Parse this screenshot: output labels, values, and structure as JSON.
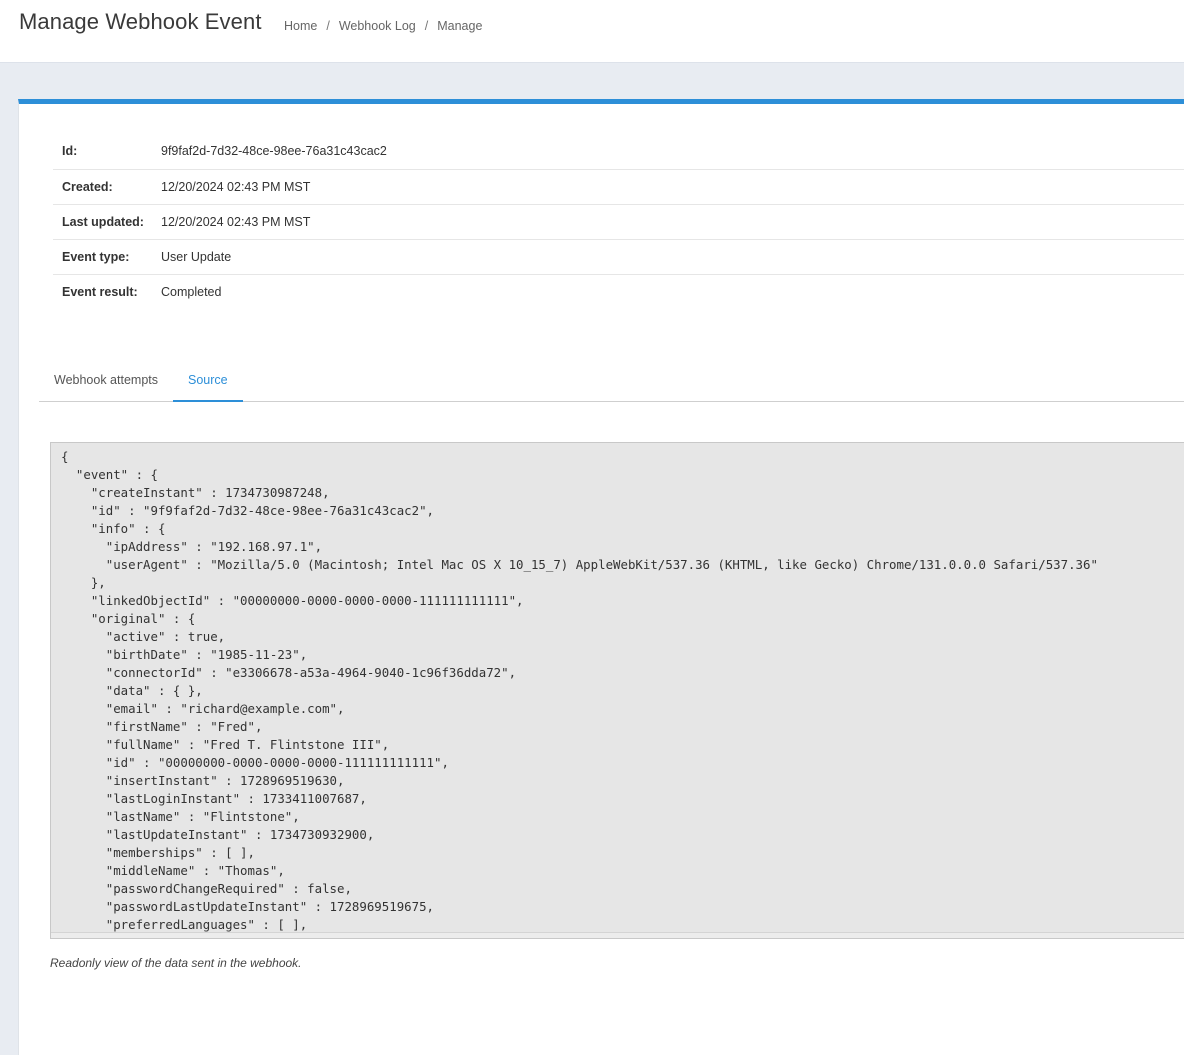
{
  "header": {
    "title": "Manage Webhook Event",
    "breadcrumb": [
      {
        "label": "Home"
      },
      {
        "label": "Webhook Log"
      },
      {
        "label": "Manage"
      }
    ],
    "separator": "/"
  },
  "details": {
    "id_label": "Id:",
    "id_value": "9f9faf2d-7d32-48ce-98ee-76a31c43cac2",
    "created_label": "Created:",
    "created_value": "12/20/2024 02:43 PM MST",
    "updated_label": "Last updated:",
    "updated_value": "12/20/2024 02:43 PM MST",
    "type_label": "Event type:",
    "type_value": "User Update",
    "result_label": "Event result:",
    "result_value": "Completed"
  },
  "tabs": [
    {
      "label": "Webhook attempts",
      "active": false
    },
    {
      "label": "Source",
      "active": true
    }
  ],
  "source": {
    "lines": [
      "{",
      "  \"event\" : {",
      "    \"createInstant\" : 1734730987248,",
      "    \"id\" : \"9f9faf2d-7d32-48ce-98ee-76a31c43cac2\",",
      "    \"info\" : {",
      "      \"ipAddress\" : \"192.168.97.1\",",
      "      \"userAgent\" : \"Mozilla/5.0 (Macintosh; Intel Mac OS X 10_15_7) AppleWebKit/537.36 (KHTML, like Gecko) Chrome/131.0.0.0 Safari/537.36\"",
      "    },",
      "    \"linkedObjectId\" : \"00000000-0000-0000-0000-111111111111\",",
      "    \"original\" : {",
      "      \"active\" : true,",
      "      \"birthDate\" : \"1985-11-23\",",
      "      \"connectorId\" : \"e3306678-a53a-4964-9040-1c96f36dda72\",",
      "      \"data\" : { },",
      "      \"email\" : \"richard@example.com\",",
      "      \"firstName\" : \"Fred\",",
      "      \"fullName\" : \"Fred T. Flintstone III\",",
      "      \"id\" : \"00000000-0000-0000-0000-111111111111\",",
      "      \"insertInstant\" : 1728969519630,",
      "      \"lastLoginInstant\" : 1733411007687,",
      "      \"lastName\" : \"Flintstone\",",
      "      \"lastUpdateInstant\" : 1734730932900,",
      "      \"memberships\" : [ ],",
      "      \"middleName\" : \"Thomas\",",
      "      \"passwordChangeRequired\" : false,",
      "      \"passwordLastUpdateInstant\" : 1728969519675,",
      "      \"preferredLanguages\" : [ ],"
    ]
  },
  "help_text": "Readonly view of the data sent in the webhook."
}
